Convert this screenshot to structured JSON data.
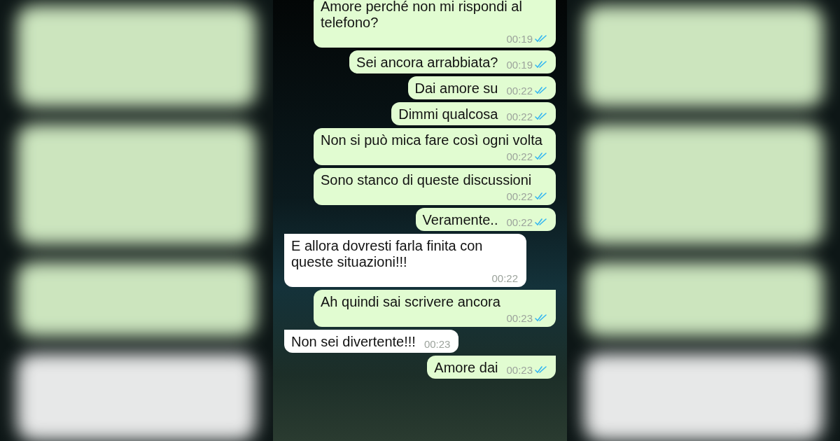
{
  "messages": [
    {
      "kind": "sent",
      "text": "Amore perché non mi rispondi al telefono?",
      "time": "00:19",
      "read": true
    },
    {
      "kind": "sent",
      "text": "Sei ancora arrabbiata?",
      "time": "00:19",
      "read": true
    },
    {
      "kind": "sent",
      "text": "Dai amore su",
      "time": "00:22",
      "read": true
    },
    {
      "kind": "sent",
      "text": "Dimmi qualcosa",
      "time": "00:22",
      "read": true
    },
    {
      "kind": "sent",
      "text": "Non si può mica fare così ogni volta",
      "time": "00:22",
      "read": true
    },
    {
      "kind": "sent",
      "text": "Sono stanco di queste discussioni",
      "time": "00:22",
      "read": true
    },
    {
      "kind": "sent",
      "text": "Veramente..",
      "time": "00:22",
      "read": true
    },
    {
      "kind": "received",
      "text": "E allora dovresti farla finita con queste situazioni!!!",
      "time": "00:22"
    },
    {
      "kind": "sent",
      "text": "Ah quindi sai scrivere ancora",
      "time": "00:23",
      "read": true
    },
    {
      "kind": "received",
      "text": "Non sei divertente!!!",
      "time": "00:23"
    },
    {
      "kind": "sent",
      "text": "Amore dai",
      "time": "00:23",
      "read": true
    }
  ]
}
